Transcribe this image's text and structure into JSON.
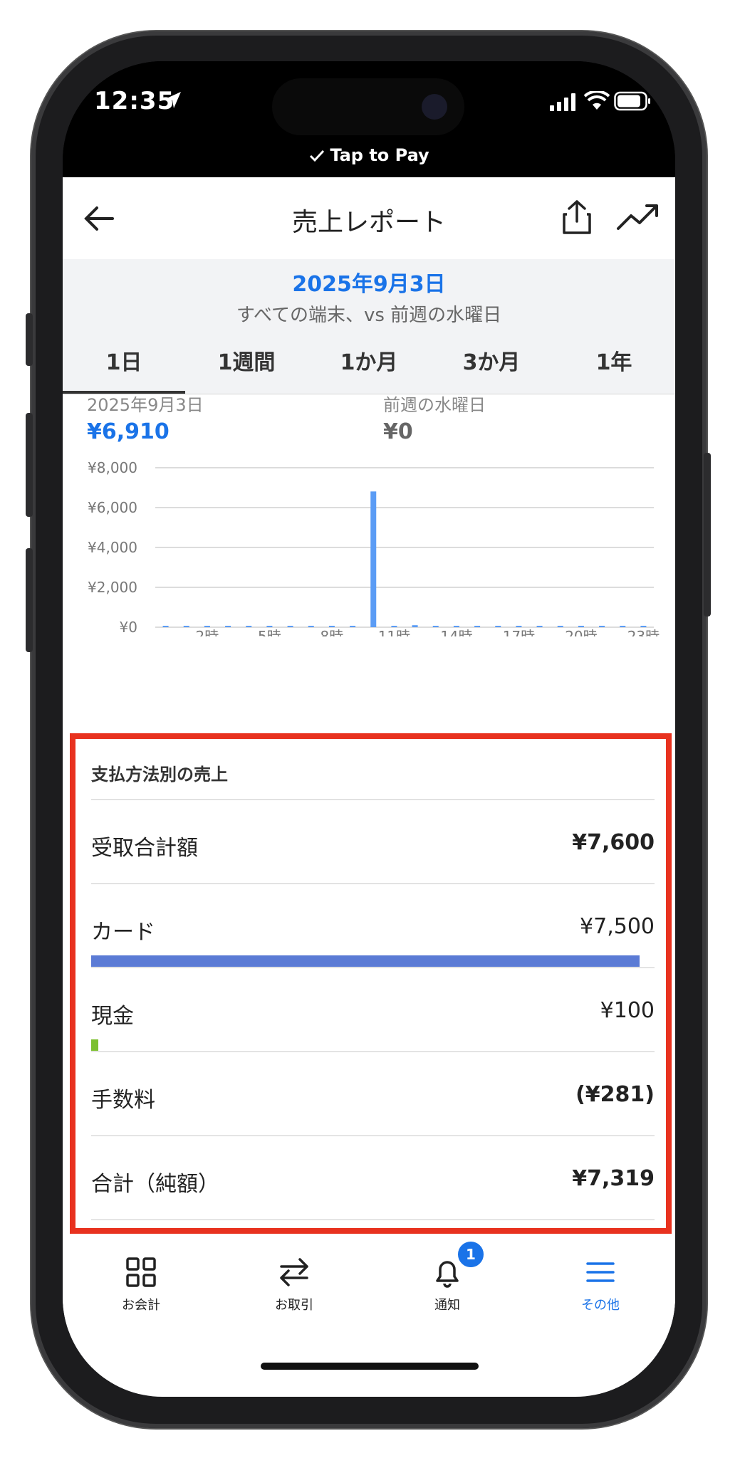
{
  "status": {
    "time": "12:35",
    "tap_to_pay": "Tap to Pay"
  },
  "nav": {
    "title": "売上レポート",
    "back_icon": "arrow-left-icon",
    "share_icon": "share-icon",
    "trend_icon": "trend-icon"
  },
  "header": {
    "date": "2025年9月3日",
    "subtitle": "すべての端末、vs 前週の水曜日"
  },
  "tabs": [
    {
      "label": "1日",
      "active": true
    },
    {
      "label": "1週間"
    },
    {
      "label": "1か月"
    },
    {
      "label": "3か月"
    },
    {
      "label": "1年"
    }
  ],
  "kpi": {
    "current_label": "2025年9月3日",
    "current_value": "¥6,910",
    "previous_label": "前週の水曜日",
    "previous_value": "¥0"
  },
  "chart_data": {
    "type": "bar",
    "x_ticks": [
      "2時",
      "5時",
      "8時",
      "11時",
      "14時",
      "17時",
      "20時",
      "23時"
    ],
    "y_ticks": [
      "¥8,000",
      "¥6,000",
      "¥4,000",
      "¥2,000",
      "¥0"
    ],
    "ylim": [
      0,
      8000
    ],
    "hours": [
      0,
      1,
      2,
      3,
      4,
      5,
      6,
      7,
      8,
      9,
      10,
      11,
      12,
      13,
      14,
      15,
      16,
      17,
      18,
      19,
      20,
      21,
      22,
      23
    ],
    "values": [
      0,
      0,
      0,
      0,
      0,
      0,
      0,
      0,
      0,
      0,
      6810,
      0,
      100,
      0,
      0,
      0,
      0,
      0,
      0,
      0,
      0,
      0,
      0,
      0
    ],
    "bar_color": "#5b9cf5"
  },
  "payments": {
    "title": "支払方法別の売上",
    "rows": [
      {
        "label": "受取合計額",
        "value": "¥7,600",
        "bold": true
      },
      {
        "label": "カード",
        "value": "¥7,500",
        "bar_fraction": 0.987,
        "bar_color": "#5b7bd5"
      },
      {
        "label": "現金",
        "value": "¥100",
        "bar_fraction": 0.013,
        "bar_color": "#7cc02f"
      },
      {
        "label": "手数料",
        "value": "(¥281)",
        "bold": true
      },
      {
        "label": "合計（純額）",
        "value": "¥7,319",
        "bold": true
      }
    ]
  },
  "tabbar": {
    "items": [
      {
        "label": "お会計",
        "icon": "grid-icon"
      },
      {
        "label": "お取引",
        "icon": "transfer-icon"
      },
      {
        "label": "通知",
        "icon": "bell-icon",
        "badge": "1"
      },
      {
        "label": "その他",
        "icon": "menu-icon",
        "active": true
      }
    ]
  },
  "colors": {
    "accent": "#1a73e8",
    "highlight_border": "#e8321f"
  }
}
